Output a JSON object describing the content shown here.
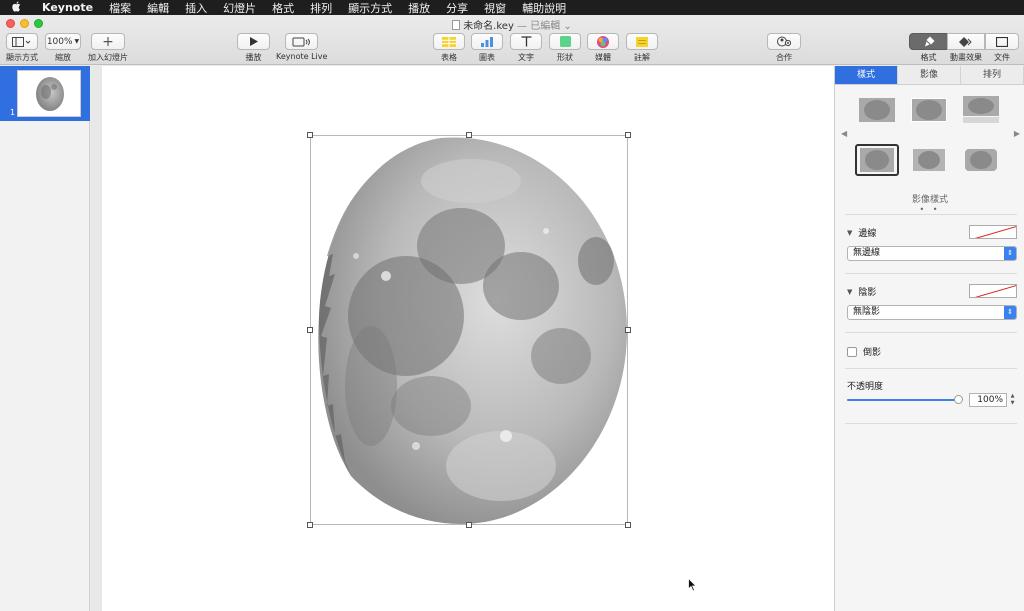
{
  "menubar": {
    "apple_icon": "apple-logo-icon",
    "items": [
      "Keynote",
      "檔案",
      "編輯",
      "插入",
      "幻燈片",
      "格式",
      "排列",
      "顯示方式",
      "播放",
      "分享",
      "視窗",
      "輔助說明"
    ]
  },
  "window": {
    "title": "未命名.key",
    "edited_suffix": "— 已編輯 ⌄"
  },
  "toolbar": {
    "view_label": "顯示方式",
    "zoom_value": "100%",
    "zoom_label": "縮放",
    "add_slide_label": "加入幻燈片",
    "play_label": "播放",
    "keynote_live_label": "Keynote Live",
    "table_label": "表格",
    "chart_label": "圖表",
    "text_label": "文字",
    "shape_label": "形狀",
    "media_label": "媒體",
    "comment_label": "註解",
    "collaborate_label": "合作",
    "format_label": "格式",
    "animate_label": "動畫效果",
    "document_label": "文件"
  },
  "navigator": {
    "slide_number": "1"
  },
  "inspector": {
    "tabs": [
      "樣式",
      "影像",
      "排列"
    ],
    "styles_caption": "影像樣式",
    "page_dots": "• •",
    "border": {
      "label": "邊線",
      "value": "無邊線"
    },
    "shadow": {
      "label": "陰影",
      "value": "無陰影"
    },
    "reflection_label": "倒影",
    "opacity": {
      "label": "不透明度",
      "value": "100%",
      "fraction": 1.0
    }
  },
  "colors": {
    "accent": "#2f6fdf",
    "menubar": "#1e1e1e"
  }
}
